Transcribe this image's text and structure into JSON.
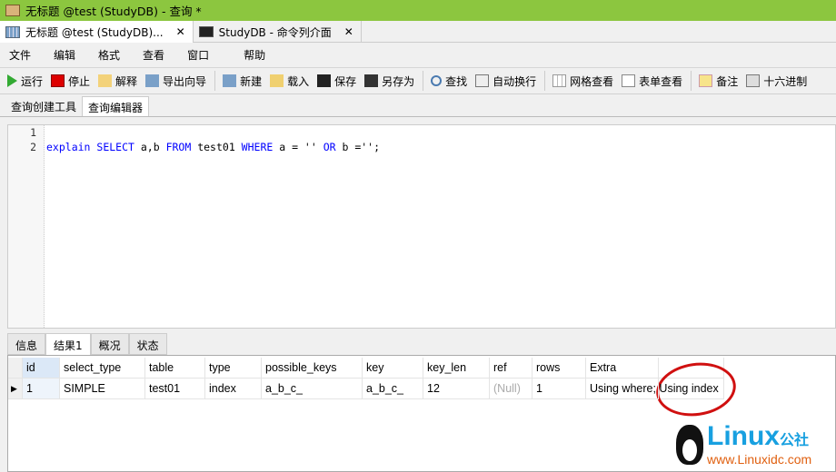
{
  "window": {
    "title": "无标题 @test (StudyDB) - 查询 *"
  },
  "tabs": [
    {
      "label": "无标题 @test (StudyDB)...",
      "icon": "grid-icon"
    },
    {
      "label": "StudyDB - 命令列介面",
      "icon": "console-icon"
    }
  ],
  "menu": [
    "文件",
    "编辑",
    "格式",
    "查看",
    "窗口",
    "帮助"
  ],
  "toolbar": [
    "运行",
    "停止",
    "解释",
    "导出向导",
    "新建",
    "载入",
    "保存",
    "另存为",
    "查找",
    "自动换行",
    "网格查看",
    "表单查看",
    "备注",
    "十六进制"
  ],
  "subtabs": [
    "查询创建工具",
    "查询编辑器"
  ],
  "editor": {
    "line_numbers": [
      "1",
      "2"
    ],
    "code": {
      "kw1": "explain",
      "kw2": "SELECT",
      "t1": " a,b ",
      "kw3": "FROM",
      "t2": " test01 ",
      "kw4": "WHERE",
      "t3": " a = '' ",
      "kw5": "OR",
      "t4": " b ='';"
    }
  },
  "result_tabs": [
    "信息",
    "结果1",
    "概况",
    "状态"
  ],
  "grid": {
    "columns": [
      "id",
      "select_type",
      "table",
      "type",
      "possible_keys",
      "key",
      "key_len",
      "ref",
      "rows",
      "Extra",
      ""
    ],
    "rows": [
      [
        "1",
        "SIMPLE",
        "test01",
        "index",
        "a_b_c_",
        "a_b_c_",
        "12",
        "(Null)",
        "1",
        "Using where; Using index",
        ""
      ]
    ]
  },
  "watermark": {
    "brand": "Linux",
    "suffix": "公社",
    "url": "www.Linuxidc.com"
  },
  "colors": {
    "titlebar": "#8cc63f",
    "keyword": "#0000ff",
    "highlight_circle": "#d01010"
  }
}
